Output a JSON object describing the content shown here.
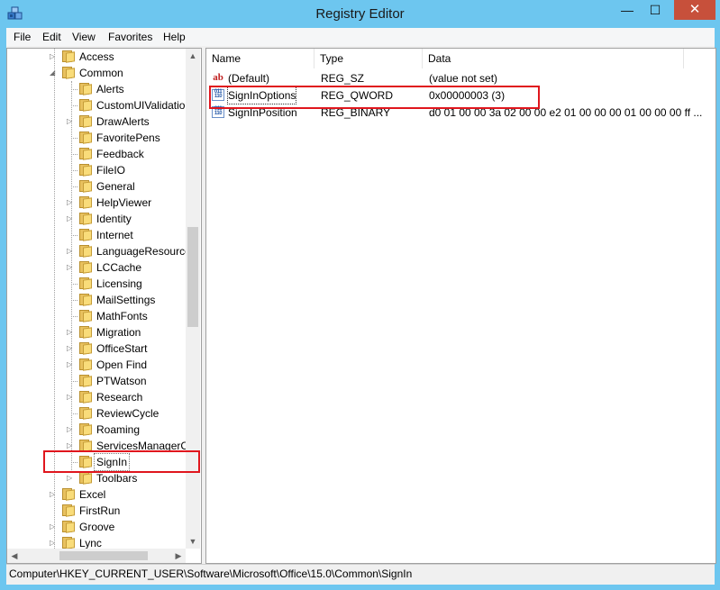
{
  "window": {
    "title": "Registry Editor",
    "close_glyph": "✕",
    "max_glyph": "☐",
    "min_glyph": "—"
  },
  "menu": [
    "File",
    "Edit",
    "View",
    "Favorites",
    "Help"
  ],
  "tree": {
    "items": [
      {
        "label": "Access",
        "expanded": false,
        "has_arrow": true
      },
      {
        "label": "Common",
        "expanded": true,
        "has_arrow": true
      },
      {
        "label": "Alerts",
        "has_arrow": false
      },
      {
        "label": "CustomUIValidatio",
        "has_arrow": false
      },
      {
        "label": "DrawAlerts",
        "has_arrow": true
      },
      {
        "label": "FavoritePens",
        "has_arrow": false
      },
      {
        "label": "Feedback",
        "has_arrow": false
      },
      {
        "label": "FileIO",
        "has_arrow": false
      },
      {
        "label": "General",
        "has_arrow": false
      },
      {
        "label": "HelpViewer",
        "has_arrow": true
      },
      {
        "label": "Identity",
        "has_arrow": true
      },
      {
        "label": "Internet",
        "has_arrow": false
      },
      {
        "label": "LanguageResource",
        "has_arrow": true
      },
      {
        "label": "LCCache",
        "has_arrow": true
      },
      {
        "label": "Licensing",
        "has_arrow": false
      },
      {
        "label": "MailSettings",
        "has_arrow": false
      },
      {
        "label": "MathFonts",
        "has_arrow": false
      },
      {
        "label": "Migration",
        "has_arrow": true
      },
      {
        "label": "OfficeStart",
        "has_arrow": true
      },
      {
        "label": "Open Find",
        "has_arrow": true
      },
      {
        "label": "PTWatson",
        "has_arrow": false
      },
      {
        "label": "Research",
        "has_arrow": true
      },
      {
        "label": "ReviewCycle",
        "has_arrow": false
      },
      {
        "label": "Roaming",
        "has_arrow": true
      },
      {
        "label": "ServicesManagerC",
        "has_arrow": true
      },
      {
        "label": "SignIn",
        "has_arrow": false,
        "selected": true
      },
      {
        "label": "Toolbars",
        "has_arrow": true
      },
      {
        "label": "Excel",
        "has_arrow": true
      },
      {
        "label": "FirstRun",
        "has_arrow": false
      },
      {
        "label": "Groove",
        "has_arrow": true
      },
      {
        "label": "Lync",
        "has_arrow": true
      }
    ],
    "scroll_up": "▲",
    "scroll_down": "▼",
    "scroll_left": "◀",
    "scroll_right": "▶"
  },
  "list": {
    "columns": [
      "Name",
      "Type",
      "Data"
    ],
    "rows": [
      {
        "icon": "string-value-icon",
        "icon_text": "ab",
        "name": "(Default)",
        "type": "REG_SZ",
        "data": "(value not set)"
      },
      {
        "icon": "binary-value-icon",
        "icon_text": "011 110",
        "name": "SignInOptions",
        "type": "REG_QWORD",
        "data": "0x00000003 (3)",
        "selected": true
      },
      {
        "icon": "binary-value-icon",
        "icon_text": "011 110",
        "name": "SignInPosition",
        "type": "REG_BINARY",
        "data": "d0 01 00 00 3a 02 00 00 e2 01 00 00 00 01 00 00 00 ff ..."
      }
    ]
  },
  "statusbar": {
    "path": "Computer\\HKEY_CURRENT_USER\\Software\\Microsoft\\Office\\15.0\\Common\\SignIn"
  },
  "colors": {
    "highlight": "#e0161d",
    "title_bg": "#6dc6ef",
    "close_bg": "#c7503b"
  }
}
